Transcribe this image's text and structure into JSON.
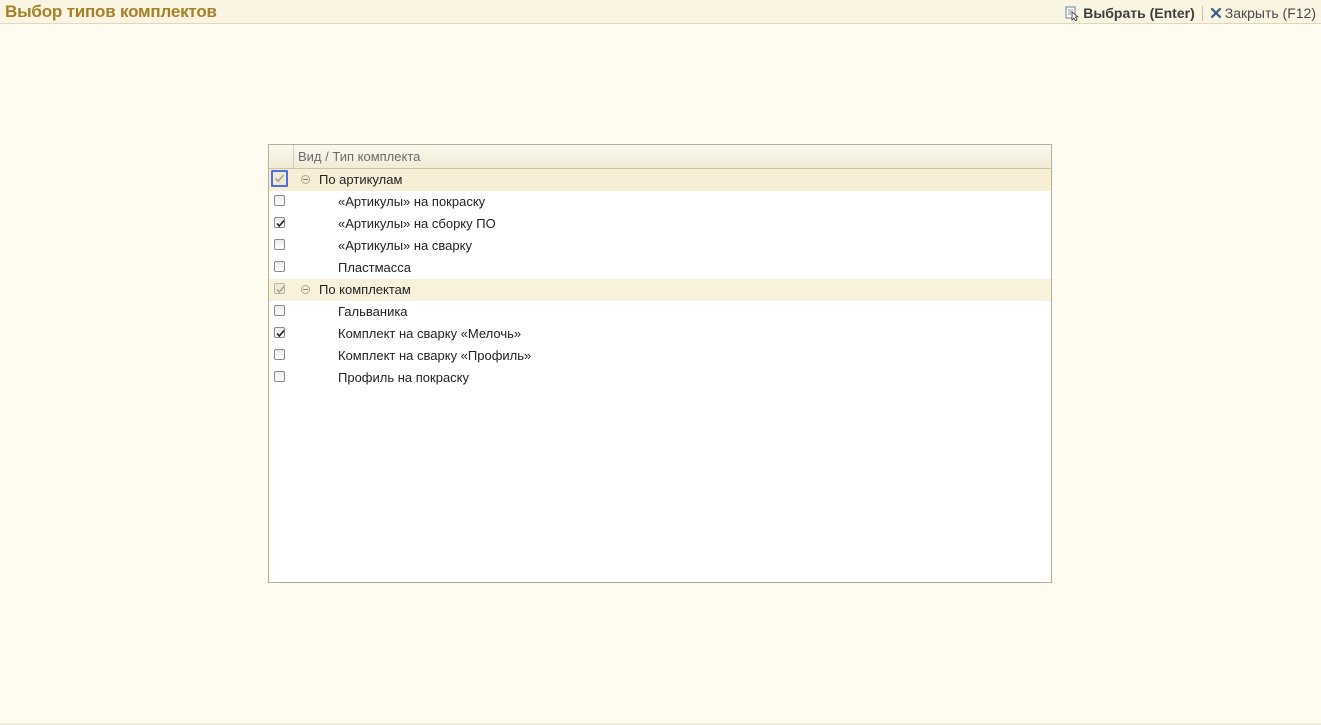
{
  "window": {
    "title": "Выбор типов комплектов"
  },
  "toolbar": {
    "select_label": "Выбрать (Enter)",
    "select_icon": "select-icon",
    "close_label": "Закрыть (F12)",
    "close_icon": "close-icon"
  },
  "tree": {
    "column_header": "Вид / Тип комплекта",
    "groups": [
      {
        "label": "По артикулам",
        "checked": true,
        "expanded": true,
        "items": [
          {
            "label": "«Артикулы» на покраску",
            "checked": false
          },
          {
            "label": "«Артикулы» на сборку ПО",
            "checked": true
          },
          {
            "label": "«Артикулы» на сварку",
            "checked": false
          },
          {
            "label": "Пластмасса",
            "checked": false
          }
        ]
      },
      {
        "label": "По комплектам",
        "checked": true,
        "expanded": true,
        "items": [
          {
            "label": "Гальваника",
            "checked": false
          },
          {
            "label": "Комплект на сварку «Мелочь»",
            "checked": true
          },
          {
            "label": "Комплект на сварку «Профиль»",
            "checked": false
          },
          {
            "label": "Профиль на покраску",
            "checked": false
          }
        ]
      }
    ]
  },
  "colors": {
    "title": "#a67f26",
    "background": "#fefbf0",
    "group_row": "#f8f2dd",
    "focus_border": "#4f6fd8"
  }
}
